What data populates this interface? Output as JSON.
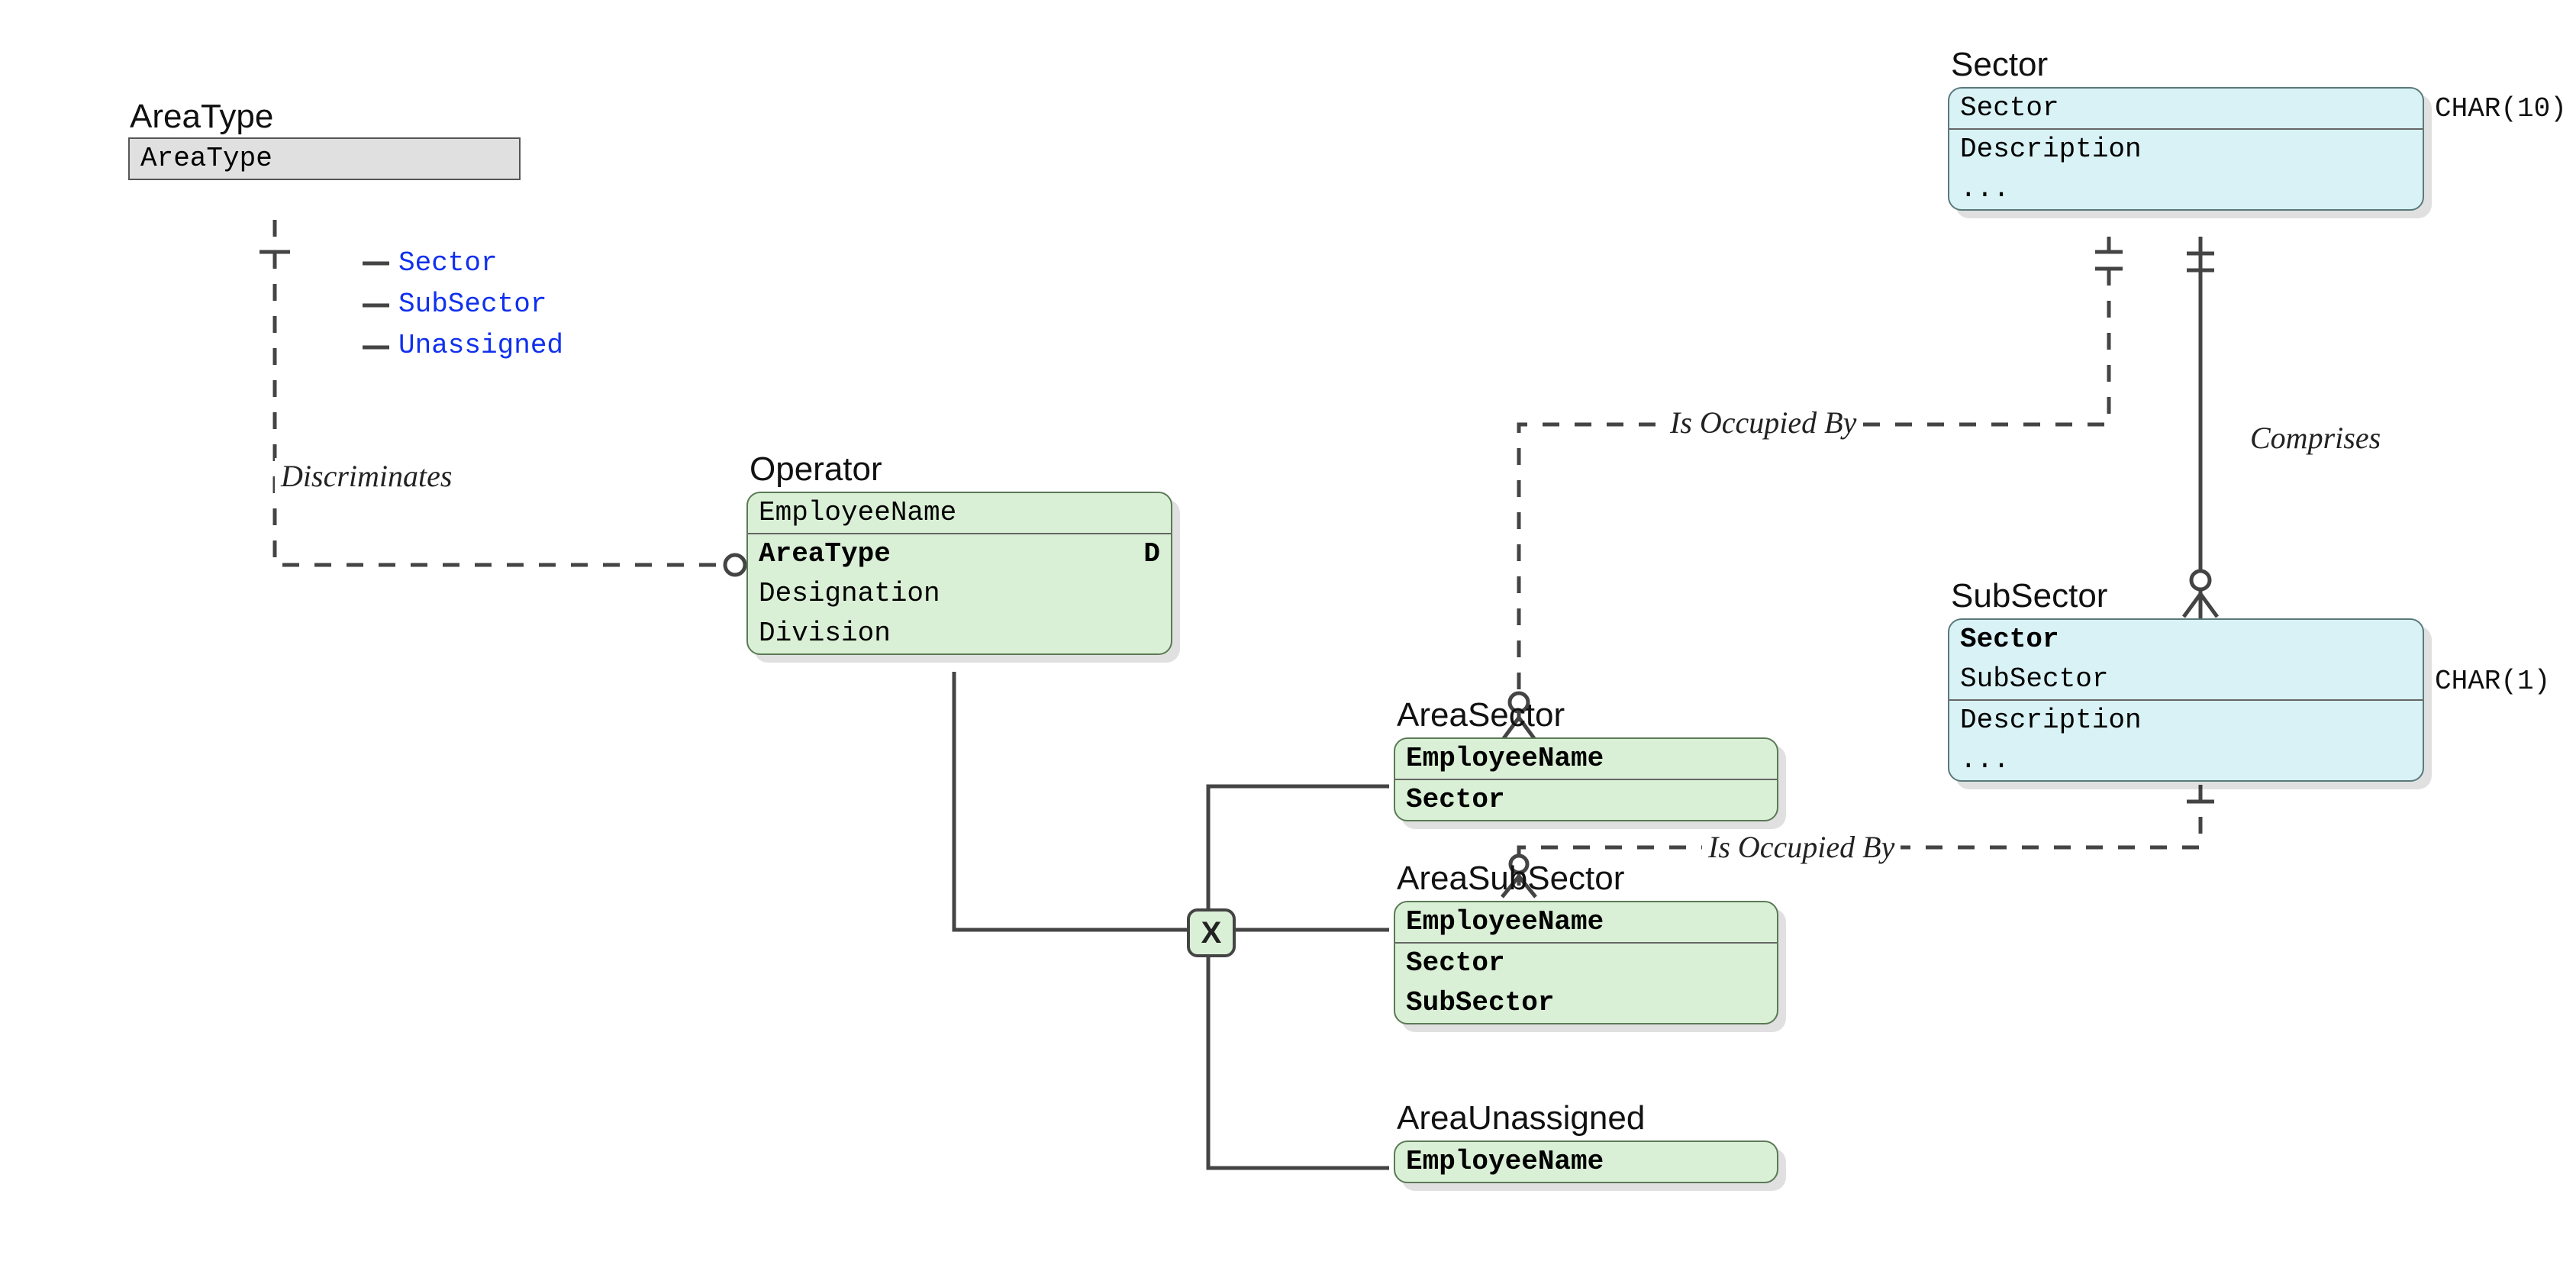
{
  "entities": {
    "areaType": {
      "title": "AreaType",
      "rows": [
        "AreaType"
      ],
      "enum": [
        "Sector",
        "SubSector",
        "Unassigned"
      ]
    },
    "operator": {
      "title": "Operator",
      "rows": [
        {
          "text": "EmployeeName"
        },
        {
          "text": "AreaType",
          "bold": true,
          "suffix": "D"
        },
        {
          "text": "Designation"
        },
        {
          "text": "Division"
        }
      ]
    },
    "sector": {
      "title": "Sector",
      "rows": [
        "Sector",
        "Description",
        "..."
      ],
      "type": "CHAR(10)"
    },
    "subSector": {
      "title": "SubSector",
      "rows": [
        {
          "text": "Sector",
          "bold": true
        },
        {
          "text": "SubSector"
        },
        {
          "text": "Description"
        },
        {
          "text": "..."
        }
      ],
      "type": "CHAR(1)"
    },
    "areaSector": {
      "title": "AreaSector",
      "rows": [
        {
          "text": "EmployeeName",
          "bold": true
        },
        {
          "text": "Sector",
          "bold": true
        }
      ]
    },
    "areaSubSector": {
      "title": "AreaSubSector",
      "rows": [
        {
          "text": "EmployeeName",
          "bold": true
        },
        {
          "text": "Sector",
          "bold": true
        },
        {
          "text": "SubSector",
          "bold": true
        }
      ]
    },
    "areaUnassigned": {
      "title": "AreaUnassigned",
      "rows": [
        {
          "text": "EmployeeName",
          "bold": true
        }
      ]
    }
  },
  "relationships": {
    "discriminates": "Discriminates",
    "occupied1": "Is Occupied By",
    "occupied2": "Is Occupied By",
    "comprises": "Comprises"
  },
  "exclusive": "X"
}
